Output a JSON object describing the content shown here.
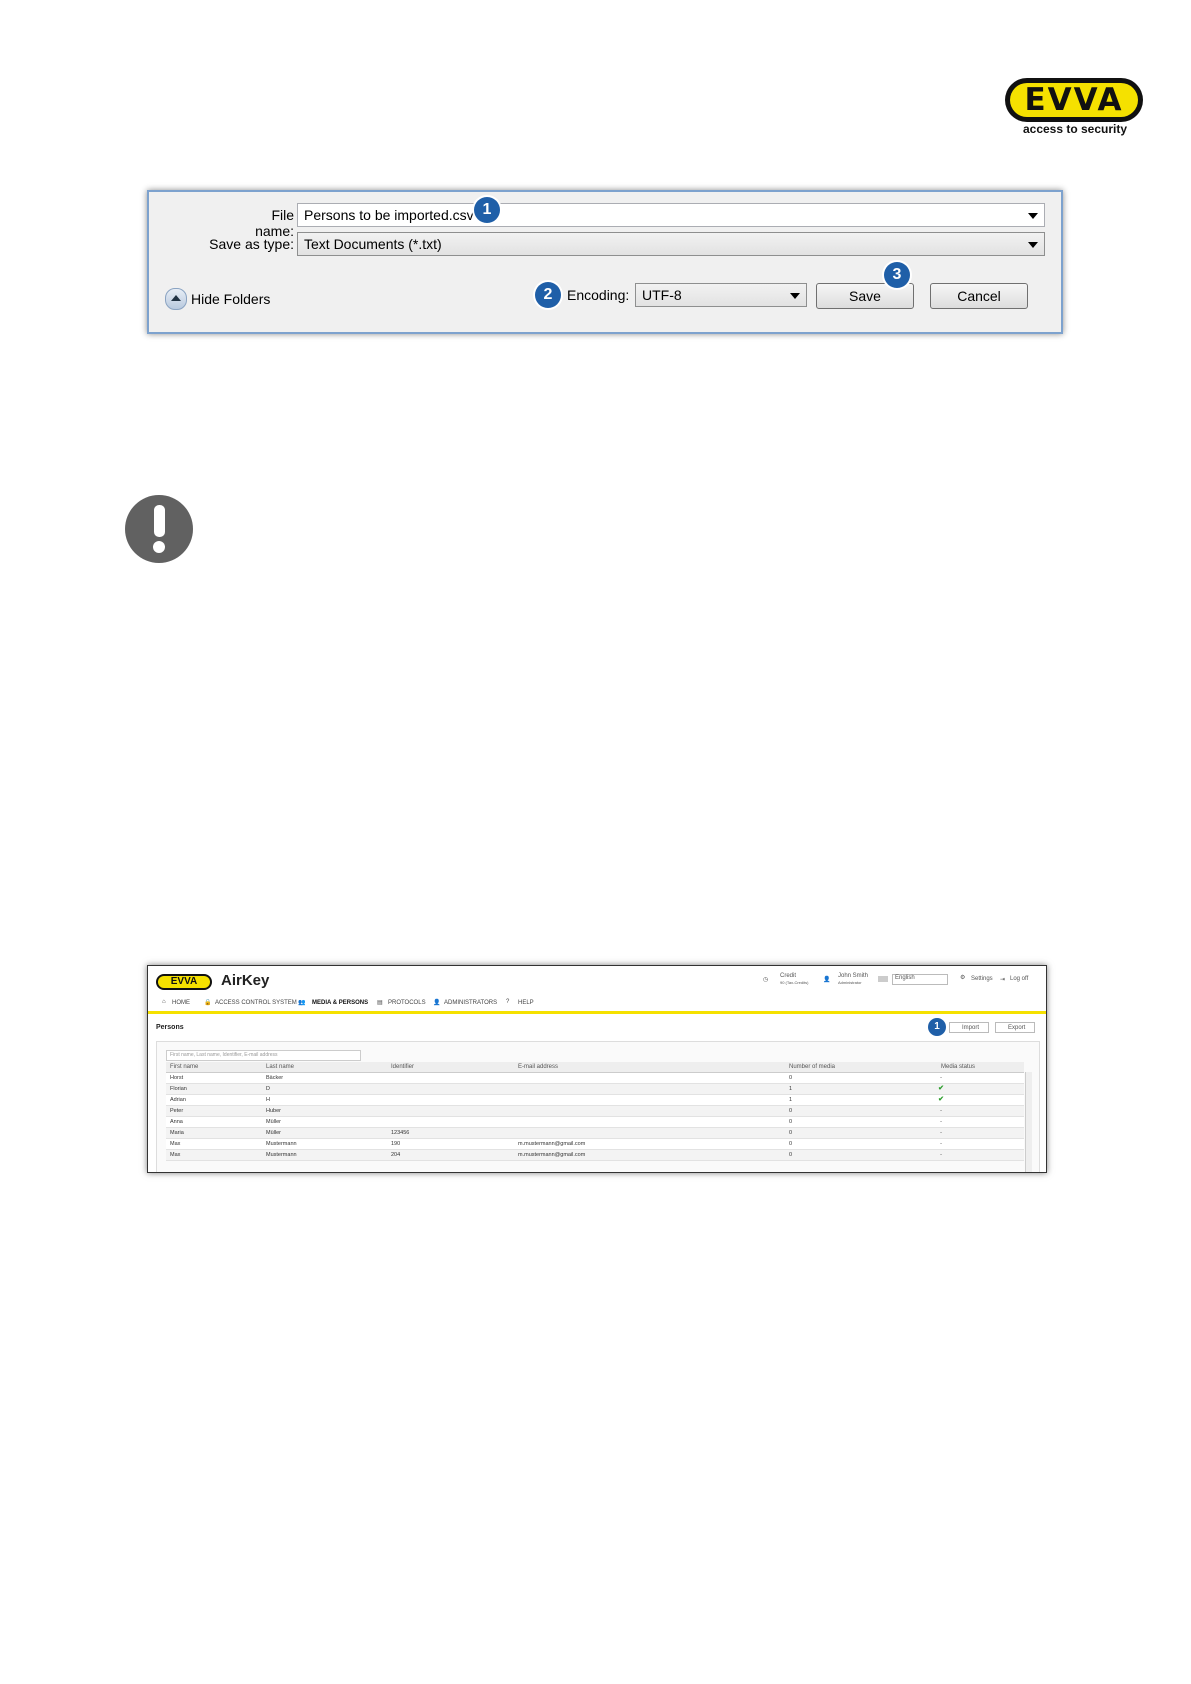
{
  "logo": {
    "brand": "EVVA",
    "tagline": "access to security"
  },
  "save_dialog": {
    "file_name_label": "File name:",
    "file_name_value": "Persons to be imported.csv",
    "save_as_type_label": "Save as type:",
    "save_as_type_value": "Text Documents (*.txt)",
    "hide_folders_label": "Hide Folders",
    "encoding_label": "Encoding:",
    "encoding_value": "UTF-8",
    "save_button": "Save",
    "cancel_button": "Cancel",
    "badges": [
      "1",
      "2",
      "3"
    ]
  },
  "warning": {
    "icon": "exclamation-icon"
  },
  "airkey": {
    "logo": "EVVA",
    "app_name": "AirKey",
    "header": {
      "credit_label": "Credit",
      "credit_value": "90 (Tax-Credits)",
      "user_name": "John Smith",
      "user_role": "Administrator",
      "language": "English",
      "settings": "Settings",
      "logout": "Log off"
    },
    "nav": [
      "HOME",
      "ACCESS CONTROL SYSTEM",
      "MEDIA & PERSONS",
      "PROTOCOLS",
      "ADMINISTRATORS",
      "HELP"
    ],
    "active_nav": "MEDIA & PERSONS",
    "page_title": "Persons",
    "import_button": "Import",
    "export_button": "Export",
    "badge": "1",
    "search_placeholder": "First name, Last name, Identifier, E-mail address",
    "columns": [
      "First name",
      "Last name",
      "Identifier",
      "E-mail address",
      "Number of media",
      "Media status"
    ],
    "rows": [
      {
        "first": "Horst",
        "last": "Bäcker",
        "id": "",
        "email": "",
        "media": "0",
        "status": "-"
      },
      {
        "first": "Florian",
        "last": "D",
        "id": "",
        "email": "",
        "media": "1",
        "status": "✔"
      },
      {
        "first": "Adrian",
        "last": "H",
        "id": "",
        "email": "",
        "media": "1",
        "status": "✔"
      },
      {
        "first": "Peter",
        "last": "Huber",
        "id": "",
        "email": "",
        "media": "0",
        "status": "-"
      },
      {
        "first": "Anna",
        "last": "Müller",
        "id": "",
        "email": "",
        "media": "0",
        "status": "-"
      },
      {
        "first": "Maria",
        "last": "Müller",
        "id": "123456",
        "email": "",
        "media": "0",
        "status": "-"
      },
      {
        "first": "Max",
        "last": "Mustermann",
        "id": "190",
        "email": "m.mustermann@gmail.com",
        "media": "0",
        "status": "-"
      },
      {
        "first": "Max",
        "last": "Mustermann",
        "id": "204",
        "email": "m.mustermann@gmail.com",
        "media": "0",
        "status": "-"
      }
    ]
  }
}
